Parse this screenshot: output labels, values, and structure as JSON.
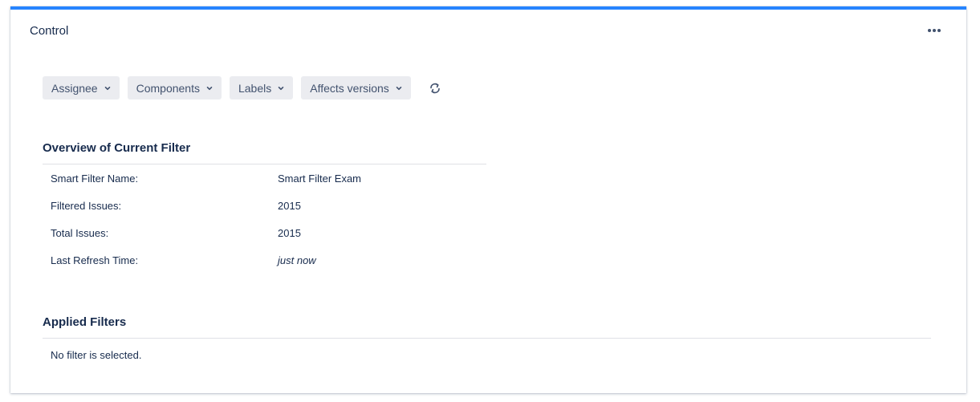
{
  "panel": {
    "title": "Control",
    "accent_color": "#2684ff",
    "more_icon": "more-horizontal-icon"
  },
  "filters": [
    {
      "label": "Assignee",
      "icon": "chevron-down-icon"
    },
    {
      "label": "Components",
      "icon": "chevron-down-icon"
    },
    {
      "label": "Labels",
      "icon": "chevron-down-icon"
    },
    {
      "label": "Affects versions",
      "icon": "chevron-down-icon"
    }
  ],
  "refresh_icon": "refresh-icon",
  "overview": {
    "title": "Overview of Current Filter",
    "rows": [
      {
        "label": "Smart Filter Name:",
        "value": "Smart Filter Exam"
      },
      {
        "label": "Filtered Issues:",
        "value": "2015"
      },
      {
        "label": "Total Issues:",
        "value": "2015"
      },
      {
        "label": "Last Refresh Time:",
        "value": "just now"
      }
    ]
  },
  "applied_filters": {
    "title": "Applied Filters",
    "empty_message": "No filter is selected."
  }
}
